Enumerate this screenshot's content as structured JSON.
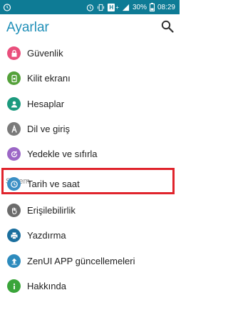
{
  "status_bar": {
    "battery": "30%",
    "time": "08:29",
    "bg_color": "#0e7b95"
  },
  "header": {
    "title": "Ayarlar",
    "accent_color": "#1f8fb8"
  },
  "personal_items": [
    {
      "label": "Güvenlik",
      "icon": "lock-icon",
      "color": "#e94f7c"
    },
    {
      "label": "Kilit ekranı",
      "icon": "screen-lock-icon",
      "color": "#54a13a"
    },
    {
      "label": "Hesaplar",
      "icon": "account-icon",
      "color": "#1c9a7e"
    },
    {
      "label": "Dil ve giriş",
      "icon": "language-icon",
      "color": "#7a7a7a"
    },
    {
      "label": "Yedekle ve sıfırla",
      "icon": "backup-icon",
      "color": "#9c67c6"
    }
  ],
  "system_section": {
    "title": "Sistem",
    "items": [
      {
        "label": "Tarih ve saat",
        "icon": "clock-icon",
        "color": "#3b8fc5"
      },
      {
        "label": "Erişilebilirlik",
        "icon": "accessibility-hand-icon",
        "color": "#6b6b6b"
      },
      {
        "label": "Yazdırma",
        "icon": "printer-icon",
        "color": "#1b6f9e"
      },
      {
        "label": "ZenUI APP güncellemeleri",
        "icon": "update-icon",
        "color": "#2d8bbd"
      },
      {
        "label": "Hakkında",
        "icon": "info-icon",
        "color": "#3aa53a"
      }
    ]
  },
  "highlight_color": "#e0242c"
}
